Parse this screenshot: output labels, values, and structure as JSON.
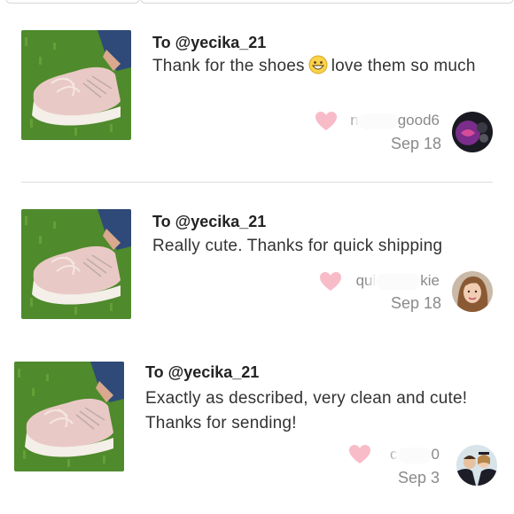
{
  "reviews": [
    {
      "to": "To @yecika_21",
      "message_before_emoji": "Thank for the shoes",
      "emoji": "grinning-face-emoji",
      "message_after_emoji": "love them so much",
      "username_prefix": "n",
      "username_suffix": "good6",
      "date": "Sep 18",
      "heart_color": "#f8bcc8"
    },
    {
      "to": "To @yecika_21",
      "message": "Really cute. Thanks for quick shipping",
      "username_prefix": "qui",
      "username_suffix": "kie",
      "date": "Sep 18",
      "heart_color": "#f8bcc8"
    },
    {
      "to": "To @yecika_21",
      "message": "Exactly as described, very clean and cute! Thanks for sending!",
      "username_prefix": "c",
      "username_suffix": "0",
      "date": "Sep 3",
      "heart_color": "#f8bcc8"
    }
  ],
  "colors": {
    "text_primary": "#222222",
    "text_secondary": "#8a8a8a",
    "divider": "#dcdcdc",
    "heart": "#f8bcc8",
    "grass": "#4f8a2c",
    "shoe": "#e9c9c6"
  }
}
